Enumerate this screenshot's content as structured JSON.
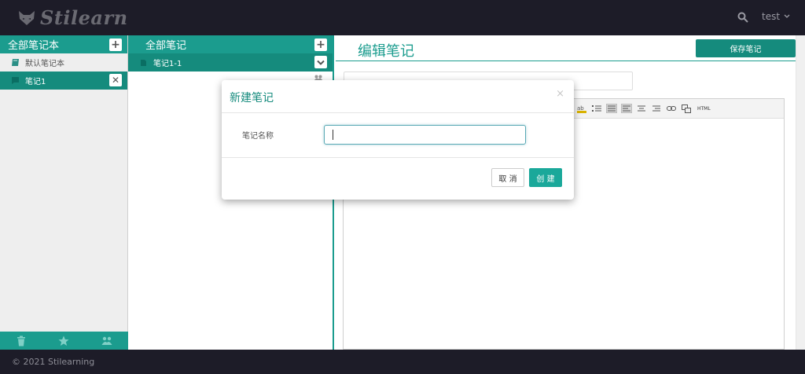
{
  "app": {
    "logo_text": "Stilearn",
    "user_name": "test",
    "footer_text": "© 2021 Stilearning"
  },
  "colors": {
    "teal": "#1b9c8e",
    "teal_dark": "#158b7d",
    "navbar": "#1d1c28",
    "create_button": "#1aa89a"
  },
  "notebooks": {
    "header": "全部笔记本",
    "add_icon": "plus-icon",
    "items": [
      {
        "label": "默认笔记本",
        "icon": "book-icon",
        "active": false
      },
      {
        "label": "笔记1",
        "icon": "notebook-icon",
        "active": true,
        "close_icon": "close-icon"
      }
    ],
    "footer_icons": [
      "trash-icon",
      "star-icon",
      "users-icon"
    ]
  },
  "notes": {
    "header": "全部笔记",
    "add_icon": "plus-icon",
    "items": [
      {
        "label": "笔记1-1",
        "icon": "document-icon",
        "menu_icon": "chevron-down-icon"
      }
    ]
  },
  "editor": {
    "title": "编辑笔记",
    "save_label": "保存笔记",
    "toolbar_html_label": "HTML",
    "toolbar_icons": [
      "highlight-color-icon",
      "ordered-list-icon",
      "unordered-list-icon",
      "align-left-icon",
      "align-center-icon",
      "align-right-icon",
      "link-icon",
      "image-icon",
      "html-icon"
    ]
  },
  "modal": {
    "title": "新建笔记",
    "close_label": "×",
    "field_label": "笔记名称",
    "field_value": "",
    "cancel_label": "取 消",
    "create_label": "创 建"
  }
}
